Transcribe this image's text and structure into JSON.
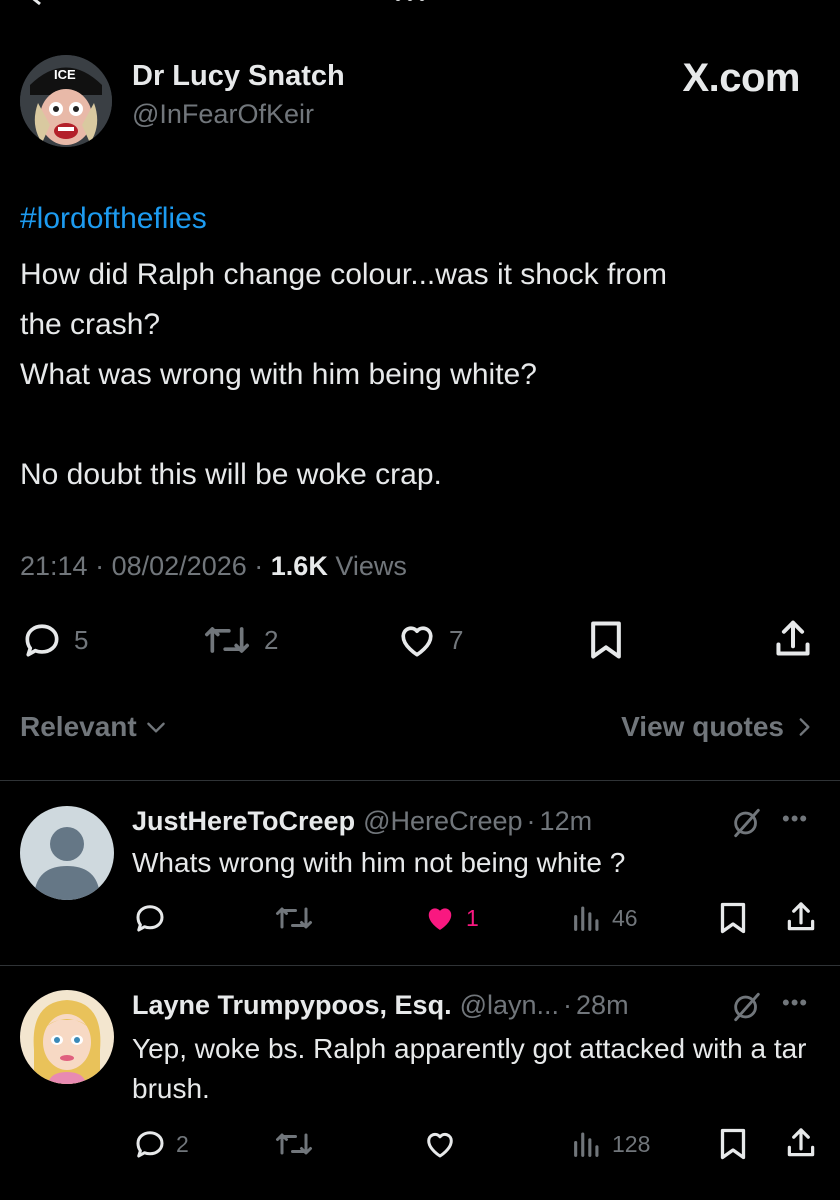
{
  "main_tweet": {
    "display_name": "Dr Lucy Snatch",
    "handle": "@InFearOfKeir",
    "brand": "X.com",
    "avatar_cap_text": "ICE",
    "hashtag": "#lordoftheflies",
    "lines": [
      "How did Ralph change colour...was it shock from",
      "the crash?",
      "What was wrong with him being white?",
      "",
      "No doubt this will be woke crap."
    ],
    "time": "21:14",
    "date": "08/02/2026",
    "views_count": "1.6K",
    "views_label": "Views",
    "separator": "·",
    "actions": {
      "replies": "5",
      "reposts": "2",
      "likes": "7"
    }
  },
  "controls": {
    "sort_label": "Relevant",
    "view_quotes_label": "View quotes"
  },
  "replies": [
    {
      "display_name": "JustHereToCreep",
      "handle": "@HereCreep",
      "time": "12m",
      "text": "Whats wrong with him not being white ?",
      "replies": "",
      "reposts": "",
      "likes": "1",
      "liked": true,
      "views": "46"
    },
    {
      "display_name": "Layne Trumpypoos, Esq.",
      "handle": "@layn...",
      "time": "28m",
      "text": "Yep, woke bs. Ralph apparently got attacked with a tar brush.",
      "replies": "2",
      "reposts": "",
      "likes": "",
      "liked": false,
      "views": "128"
    }
  ],
  "colors": {
    "background": "#000000",
    "text": "#e7e9ea",
    "muted": "#71767b",
    "link": "#1d9bf0",
    "like_active": "#f91880",
    "divider": "#2f3336"
  },
  "icons": [
    "reply-icon",
    "repost-icon",
    "like-icon",
    "bookmark-icon",
    "share-icon",
    "views-icon",
    "grok-icon",
    "more-icon",
    "chevron-down-icon",
    "chevron-right-icon"
  ]
}
